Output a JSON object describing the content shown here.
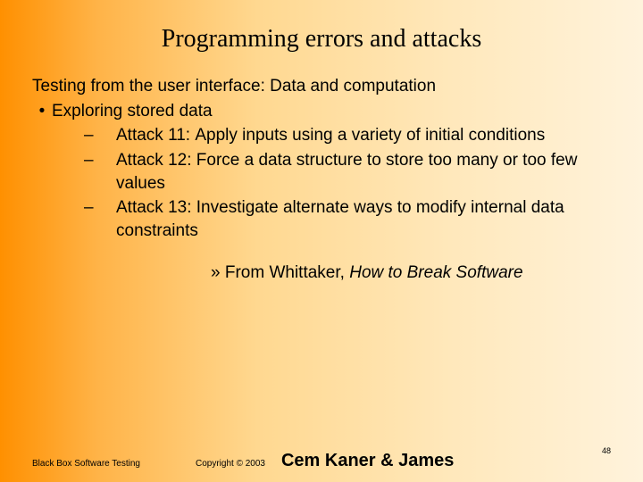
{
  "title": "Programming errors and attacks",
  "subtitle": "Testing from the user interface: Data and computation",
  "bullet": {
    "mark": "•",
    "text": "Exploring stored data"
  },
  "attacks": [
    {
      "dash": "–",
      "label": "Attack 11:",
      "text": "Apply inputs using a variety of initial conditions"
    },
    {
      "dash": "–",
      "label": "Attack 12:",
      "text": "Force a data structure to store too many or too few values"
    },
    {
      "dash": "–",
      "label": "Attack 13:",
      "text": "Investigate alternate ways to modify internal data constraints"
    }
  ],
  "citation": {
    "prefix": "» ",
    "author": "From Whittaker, ",
    "title": "How to Break Software"
  },
  "footer": {
    "left": "Black Box Software Testing",
    "copyright": "Copyright ©  2003",
    "authors": "Cem Kaner & James"
  },
  "page_number": "48"
}
